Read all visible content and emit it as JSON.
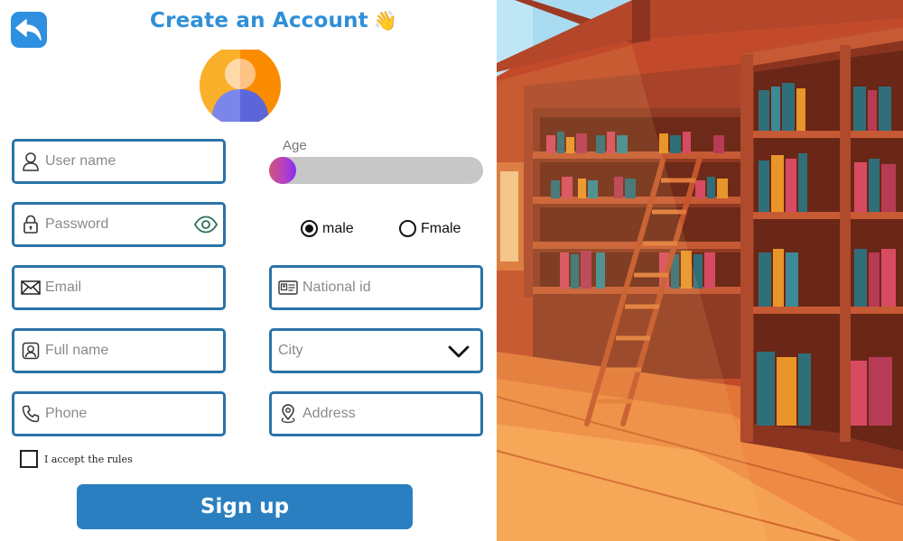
{
  "header": {
    "title": "Create an Account",
    "title_emoji": "👋"
  },
  "icons": {
    "back": "back-arrow-icon",
    "avatar": "user-avatar-icon",
    "username": "user-icon",
    "password": "lock-icon",
    "show_password": "eye-icon",
    "email": "envelope-icon",
    "fullname": "contact-card-icon",
    "phone": "phone-icon",
    "national_id": "id-card-icon",
    "city_dropdown": "chevron-down-icon",
    "address": "location-pin-icon"
  },
  "fields": {
    "username": {
      "placeholder": "User name",
      "value": ""
    },
    "password": {
      "placeholder": "Password",
      "value": ""
    },
    "email": {
      "placeholder": "Email",
      "value": ""
    },
    "fullname": {
      "placeholder": "Full name",
      "value": ""
    },
    "phone": {
      "placeholder": "Phone",
      "value": ""
    },
    "national_id": {
      "placeholder": "National id",
      "value": ""
    },
    "city": {
      "selected": "City"
    },
    "address": {
      "placeholder": "Address",
      "value": ""
    }
  },
  "age": {
    "label": "Age",
    "value_fraction": 0.0
  },
  "gender": {
    "options": [
      "male",
      "Fmale"
    ],
    "selected": "male"
  },
  "rules": {
    "label": "I accept the rules",
    "checked": false
  },
  "actions": {
    "signup_label": "Sign up"
  },
  "colors": {
    "accent": "#2f8fd8",
    "field_border": "#2a73a8",
    "button": "#2a7fc0",
    "avatar_bg": "#fb8c00"
  }
}
